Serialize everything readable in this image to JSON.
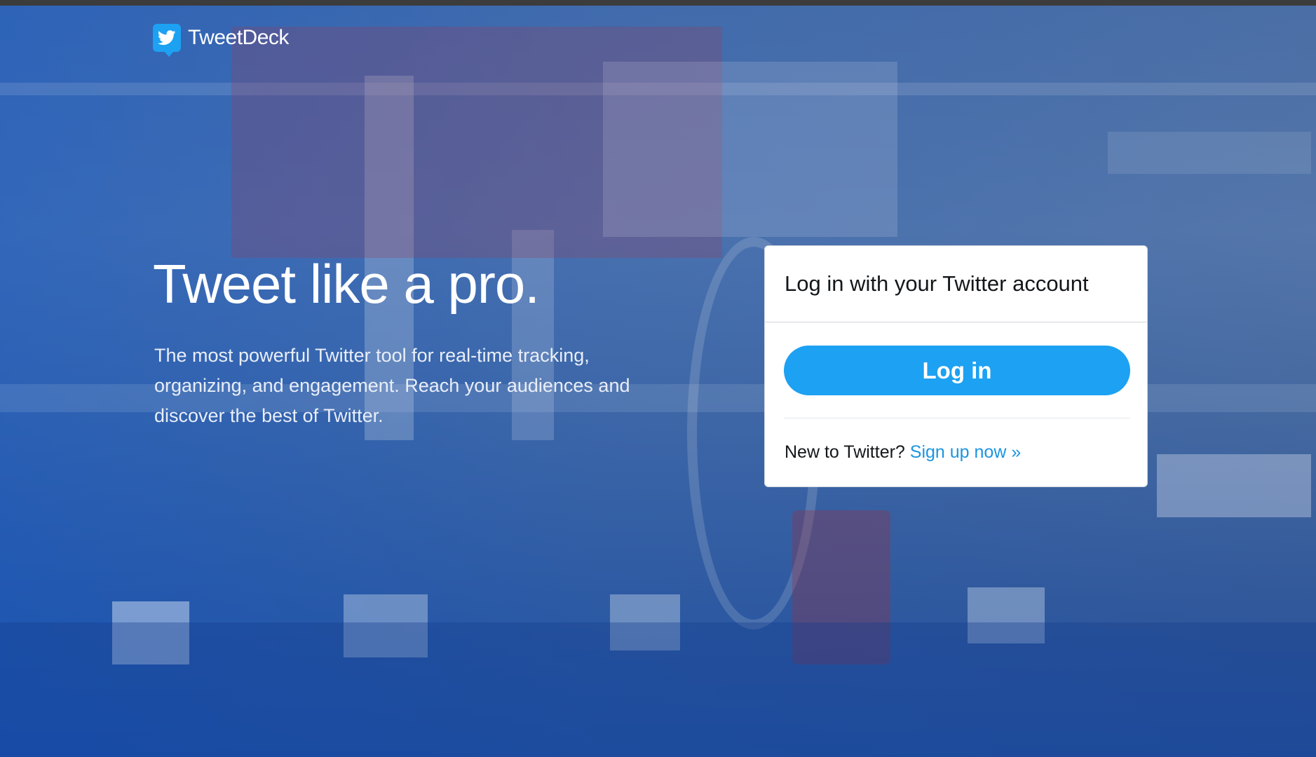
{
  "app": {
    "name": "TweetDeck"
  },
  "hero": {
    "headline": "Tweet like a pro.",
    "description": "The most powerful Twitter tool for real-time tracking, organizing, and engagement. Reach your audiences and discover the best of Twitter."
  },
  "login_card": {
    "title": "Log in with your Twitter account",
    "login_button": "Log in",
    "signup_prompt": "New to Twitter?",
    "signup_link": "Sign up now »"
  },
  "icons": {
    "logo": "twitter-bird-icon"
  },
  "colors": {
    "accent": "#1da1f2",
    "link": "#1b95e0",
    "overlay": "#1f4c9c"
  }
}
